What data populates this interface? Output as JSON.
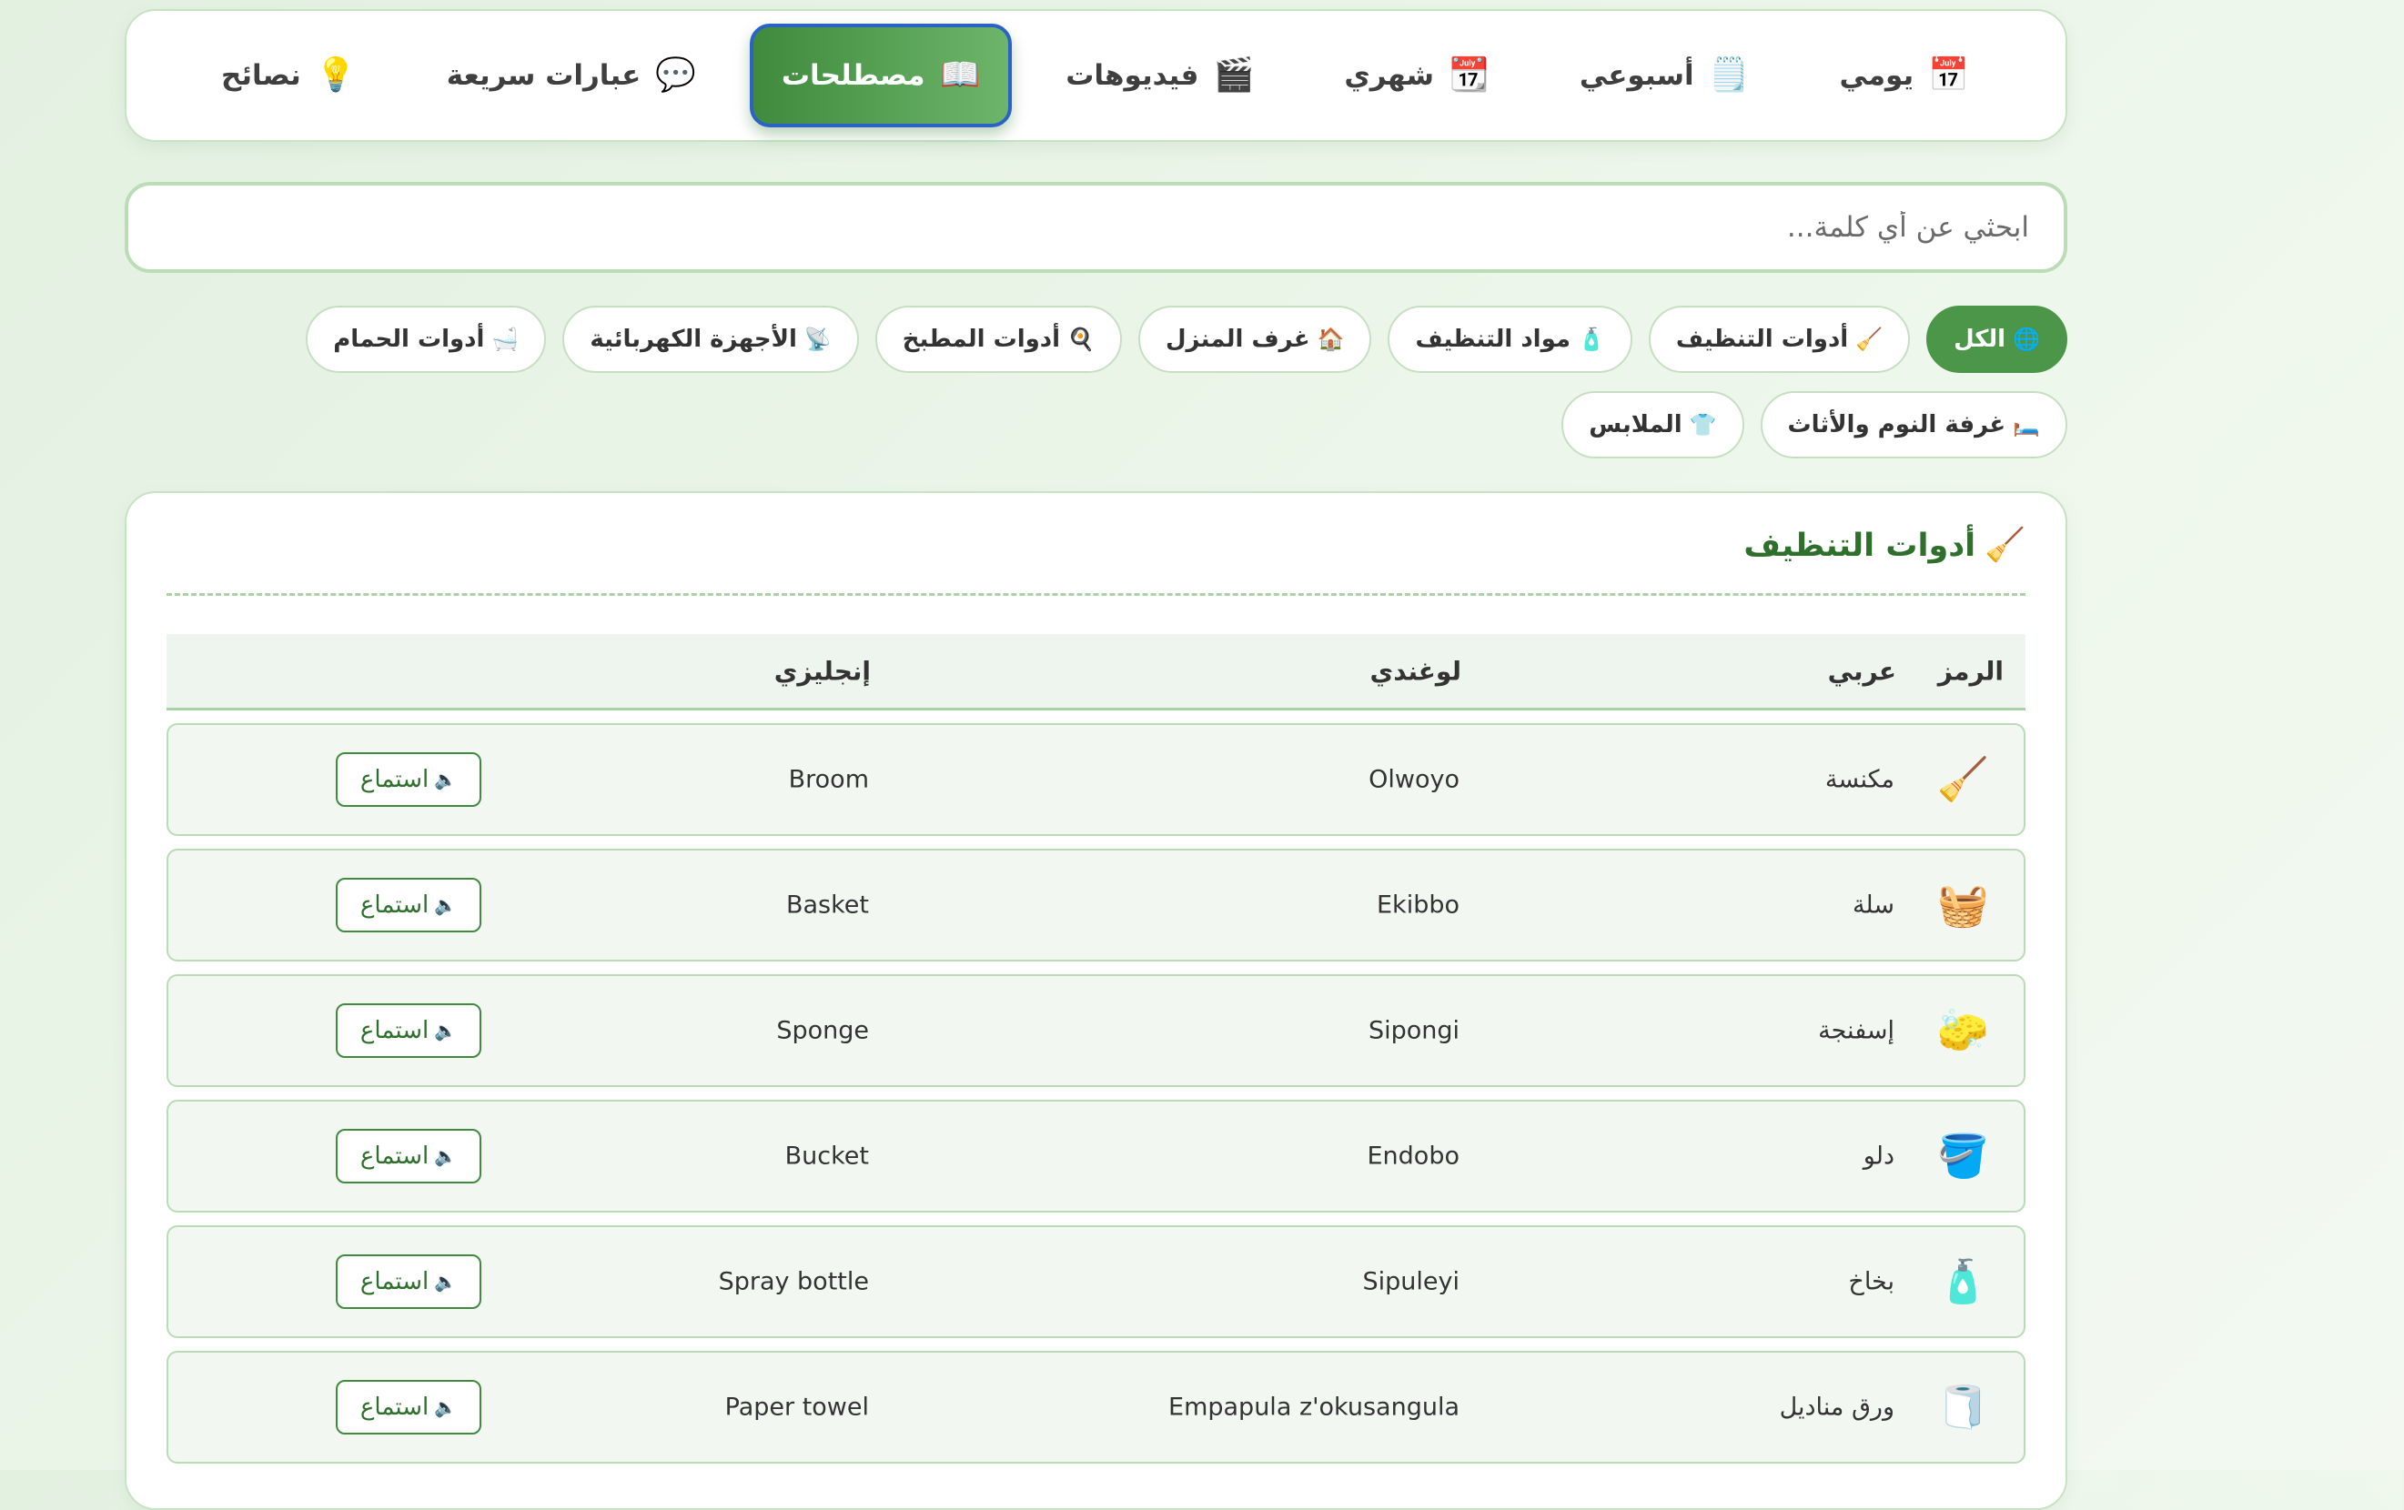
{
  "nav": {
    "tabs": [
      {
        "icon": "📅",
        "icon_name": "calendar-icon",
        "label": "يومي"
      },
      {
        "icon": "🗒️",
        "icon_name": "notepad-icon",
        "label": "أسبوعي"
      },
      {
        "icon": "📆",
        "icon_name": "calendar-month-icon",
        "label": "شهري"
      },
      {
        "icon": "🎬",
        "icon_name": "clapperboard-icon",
        "label": "فيديوهات"
      },
      {
        "icon": "📖",
        "icon_name": "book-icon",
        "label": "مصطلحات"
      },
      {
        "icon": "💬",
        "icon_name": "speech-bubble-icon",
        "label": "عبارات سريعة"
      },
      {
        "icon": "💡",
        "icon_name": "lightbulb-icon",
        "label": "نصائح"
      }
    ],
    "active_index": 4
  },
  "search": {
    "placeholder": "ابحثي عن أي كلمة..."
  },
  "filters": {
    "chips": [
      {
        "icon": "🌐",
        "label": "الكل"
      },
      {
        "icon": "🧹",
        "label": "أدوات التنظيف"
      },
      {
        "icon": "🧴",
        "label": "مواد التنظيف"
      },
      {
        "icon": "🏠",
        "label": "غرف المنزل"
      },
      {
        "icon": "🍳",
        "label": "أدوات المطبخ"
      },
      {
        "icon": "📡",
        "label": "الأجهزة الكهربائية"
      },
      {
        "icon": "🛁",
        "label": "أدوات الحمام"
      },
      {
        "icon": "🛏️",
        "label": "غرفة النوم والأثاث"
      },
      {
        "icon": "👕",
        "label": "الملابس"
      }
    ],
    "active_index": 0
  },
  "section": {
    "icon": "🧹",
    "title": "أدوات التنظيف",
    "columns": {
      "symbol": "الرمز",
      "arabic": "عربي",
      "luganda": "لوغندي",
      "english": "إنجليزي"
    },
    "listen_label": "استماع",
    "listen_icon": "🔈",
    "rows": [
      {
        "symbol": "🧹",
        "arabic": "مكنسة",
        "luganda": "Olwoyo",
        "english": "Broom"
      },
      {
        "symbol": "🧺",
        "arabic": "سلة",
        "luganda": "Ekibbo",
        "english": "Basket"
      },
      {
        "symbol": "🧽",
        "arabic": "إسفنجة",
        "luganda": "Sipongi",
        "english": "Sponge"
      },
      {
        "symbol": "🪣",
        "arabic": "دلو",
        "luganda": "Endobo",
        "english": "Bucket"
      },
      {
        "symbol": "🧴",
        "arabic": "بخاخ",
        "luganda": "Sipuleyi",
        "english": "Spray bottle"
      },
      {
        "symbol": "🧻",
        "arabic": "ورق مناديل",
        "luganda": "Empapula z'okusangula",
        "english": "Paper towel"
      }
    ]
  },
  "colors": {
    "accent": "#4b9648",
    "active_border": "#2a62c8",
    "title": "#2f6f2c"
  }
}
